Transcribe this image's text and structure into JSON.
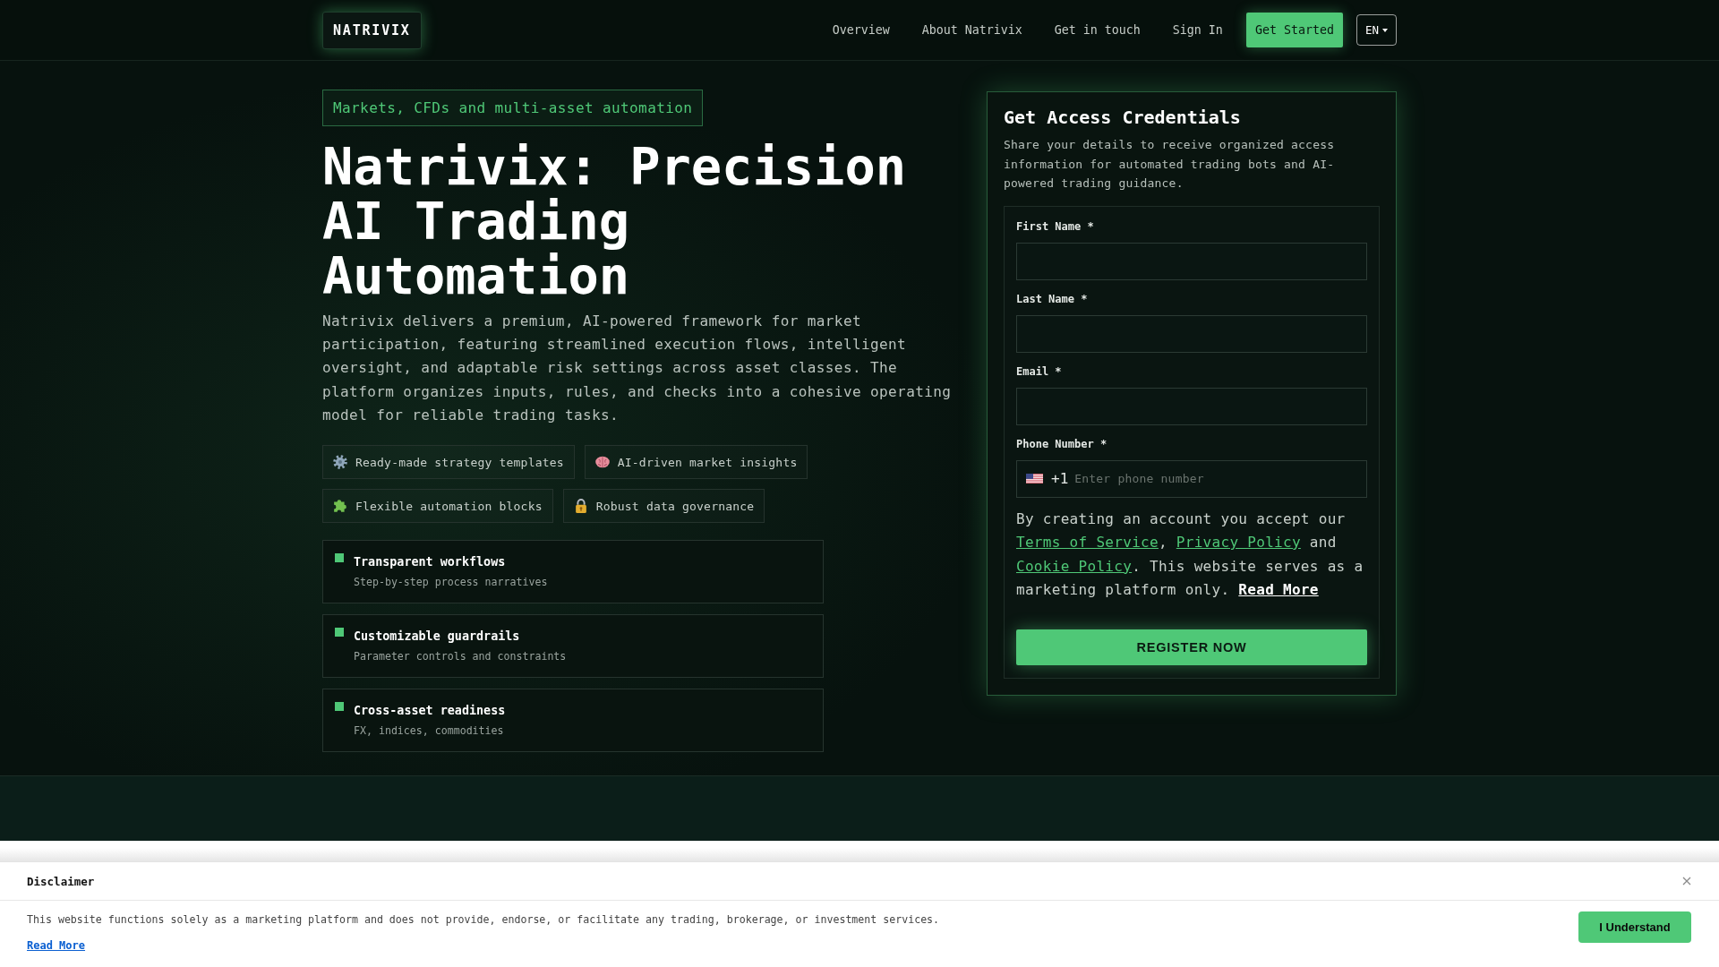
{
  "header": {
    "logo": "NATRIVIX",
    "nav": [
      {
        "label": "Overview"
      },
      {
        "label": "About Natrivix"
      },
      {
        "label": "Get in touch"
      },
      {
        "label": "Sign In"
      }
    ],
    "cta": "Get Started",
    "language": "EN"
  },
  "hero": {
    "badge": "Markets, CFDs and multi-asset automation",
    "title": "Natrivix: Precision AI Trading Automation",
    "description": "Natrivix delivers a premium, AI-powered framework for market participation, featuring streamlined execution flows, intelligent oversight, and adaptable risk settings across asset classes. The platform organizes inputs, rules, and checks into a cohesive operating model for reliable trading tasks.",
    "chips": [
      {
        "kind": "gear",
        "label": "Ready-made strategy templates"
      },
      {
        "kind": "brain",
        "label": "AI-driven market insights"
      },
      {
        "kind": "puzzle",
        "label": "Flexible automation blocks"
      },
      {
        "kind": "lock",
        "label": "Robust data governance"
      }
    ],
    "features": [
      {
        "title": "Transparent workflows",
        "subtitle": "Step-by-step process narratives"
      },
      {
        "title": "Customizable guardrails",
        "subtitle": "Parameter controls and constraints"
      },
      {
        "title": "Cross-asset readiness",
        "subtitle": "FX, indices, commodities"
      }
    ]
  },
  "signup": {
    "title": "Get Access Credentials",
    "description": "Share your details to receive organized access information for automated trading bots and AI-powered trading guidance.",
    "fields": [
      {
        "kind": "text",
        "label": "First Name *"
      },
      {
        "kind": "text",
        "label": "Last Name *"
      },
      {
        "kind": "text",
        "label": "Email *"
      },
      {
        "kind": "phone",
        "label": "Phone Number *",
        "dial_code": "+1",
        "placeholder": "Enter phone number"
      }
    ],
    "consent": [
      {
        "kind": "text",
        "text": "By creating an account you accept our "
      },
      {
        "kind": "link",
        "text": "Terms of Service"
      },
      {
        "kind": "text",
        "text": ", "
      },
      {
        "kind": "link",
        "text": "Privacy Policy"
      },
      {
        "kind": "text",
        "text": " and "
      },
      {
        "kind": "link",
        "text": "Cookie Policy"
      },
      {
        "kind": "text",
        "text": ". This website serves as a marketing platform only. "
      },
      {
        "kind": "more",
        "text": "Read More"
      }
    ],
    "submit": "REGISTER NOW"
  },
  "disclaimer": {
    "title": "Disclaimer",
    "text": "This website functions solely as a marketing platform and does not provide, endorse, or facilitate any trading, brokerage, or investment services.",
    "link": "Read More",
    "button": "I Understand"
  }
}
